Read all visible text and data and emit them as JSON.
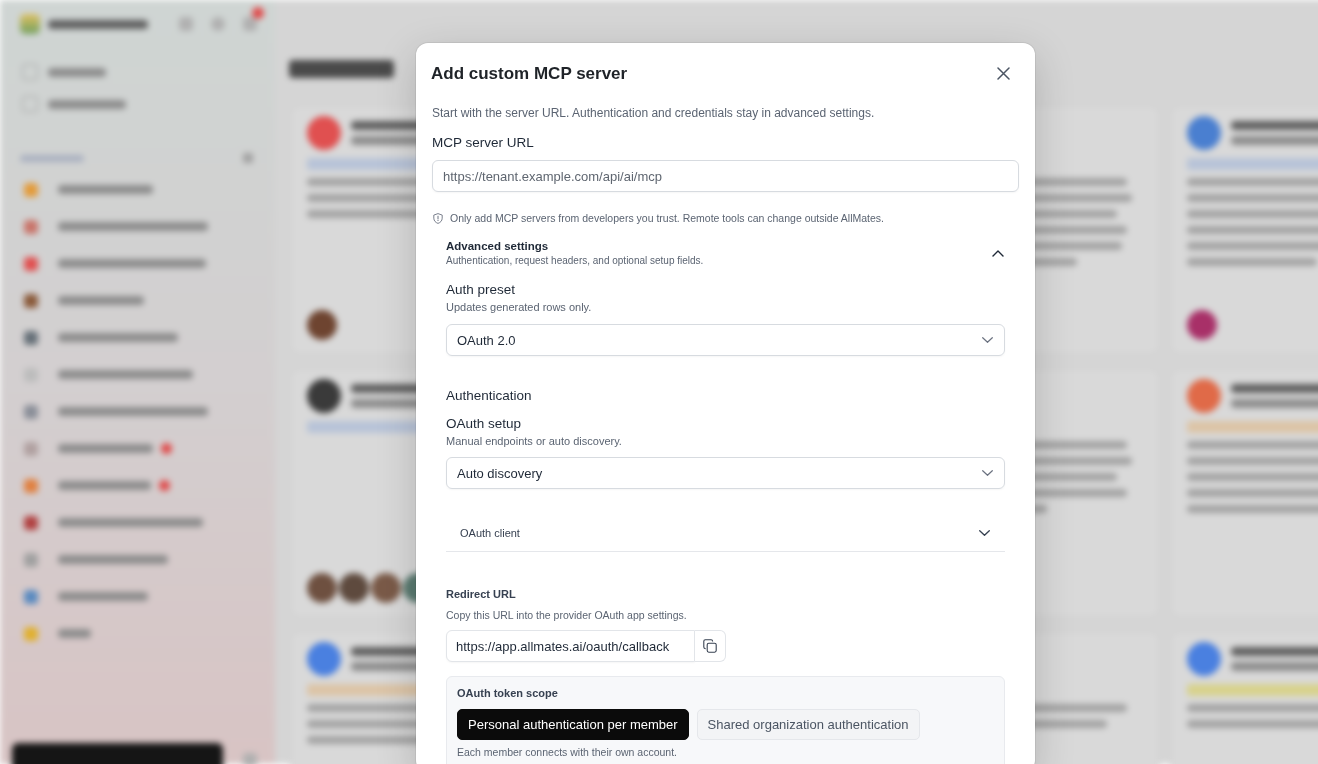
{
  "dialog": {
    "title": "Add custom MCP server",
    "description": "Start with the server URL. Authentication and credentials stay in advanced settings.",
    "server_url": {
      "label": "MCP server URL",
      "placeholder": "https://tenant.example.com/api/ai/mcp"
    },
    "notice": "Only add MCP servers from developers you trust. Remote tools can change outside AllMates.",
    "advanced": {
      "title": "Advanced settings",
      "description": "Authentication, request headers, and optional setup fields.",
      "expanded": true,
      "auth_preset": {
        "label": "Auth preset",
        "hint": "Updates generated rows only.",
        "value": "OAuth 2.0"
      },
      "authentication_heading": "Authentication",
      "oauth_setup": {
        "label": "OAuth setup",
        "hint": "Manual endpoints or auto discovery.",
        "value": "Auto discovery"
      },
      "oauth_client": {
        "label": "OAuth client",
        "expanded": false
      },
      "redirect_url": {
        "label": "Redirect URL",
        "hint": "Copy this URL into the provider OAuth app settings.",
        "value": "https://app.allmates.ai/oauth/callback"
      },
      "token_scope": {
        "label": "OAuth token scope",
        "options": [
          {
            "label": "Personal authentication per member",
            "selected": true
          },
          {
            "label": "Shared organization authentication",
            "selected": false
          }
        ],
        "note": "Each member connects with their own account."
      }
    }
  }
}
